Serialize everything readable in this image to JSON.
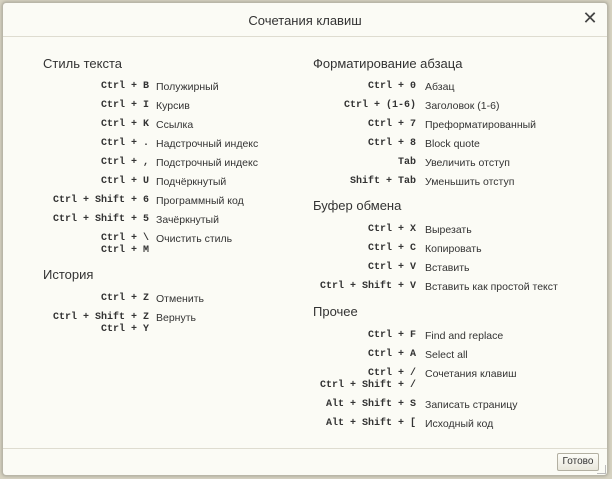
{
  "dialog": {
    "title": "Сочетания клавиш",
    "close_label": "✕",
    "ok_label": "Готово"
  },
  "left": {
    "text_style": {
      "title": "Стиль текста",
      "items": [
        {
          "keys": "Ctrl + B",
          "desc": "Полужирный"
        },
        {
          "keys": "Ctrl + I",
          "desc": "Курсив"
        },
        {
          "keys": "Ctrl + K",
          "desc": "Ссылка"
        },
        {
          "keys": "Ctrl + .",
          "desc": "Надстрочный индекс"
        },
        {
          "keys": "Ctrl + ,",
          "desc": "Подстрочный индекс"
        },
        {
          "keys": "Ctrl + U",
          "desc": "Подчёркнутый"
        },
        {
          "keys": "Ctrl + Shift + 6",
          "desc": "Программный код"
        },
        {
          "keys": "Ctrl + Shift + 5",
          "desc": "Зачёркнутый"
        },
        {
          "keys": "Ctrl + \\",
          "keys2": "Ctrl + M",
          "desc": "Очистить стиль"
        }
      ]
    },
    "history": {
      "title": "История",
      "items": [
        {
          "keys": "Ctrl + Z",
          "desc": "Отменить"
        },
        {
          "keys": "Ctrl + Shift + Z",
          "keys2": "Ctrl + Y",
          "desc": "Вернуть"
        }
      ]
    }
  },
  "right": {
    "paragraph": {
      "title": "Форматирование абзаца",
      "items": [
        {
          "keys": "Ctrl + 0",
          "desc": "Абзац"
        },
        {
          "keys": "Ctrl + (1-6)",
          "desc": "Заголовок (1-6)"
        },
        {
          "keys": "Ctrl + 7",
          "desc": "Преформатированный"
        },
        {
          "keys": "Ctrl + 8",
          "desc": "Block quote"
        },
        {
          "keys": "Tab",
          "desc": "Увеличить отступ"
        },
        {
          "keys": "Shift + Tab",
          "desc": "Уменьшить отступ"
        }
      ]
    },
    "clipboard": {
      "title": "Буфер обмена",
      "items": [
        {
          "keys": "Ctrl + X",
          "desc": "Вырезать"
        },
        {
          "keys": "Ctrl + C",
          "desc": "Копировать"
        },
        {
          "keys": "Ctrl + V",
          "desc": "Вставить"
        },
        {
          "keys": "Ctrl + Shift + V",
          "desc": "Вставить как простой текст"
        }
      ]
    },
    "other": {
      "title": "Прочее",
      "items": [
        {
          "keys": "Ctrl + F",
          "desc": "Find and replace"
        },
        {
          "keys": "Ctrl + A",
          "desc": "Select all"
        },
        {
          "keys": "Ctrl + /",
          "keys2": "Ctrl + Shift + /",
          "desc": "Сочетания клавиш"
        },
        {
          "keys": "Alt + Shift + S",
          "desc": "Записать страницу"
        },
        {
          "keys": "Alt + Shift + [",
          "desc": "Исходный код"
        }
      ]
    }
  }
}
